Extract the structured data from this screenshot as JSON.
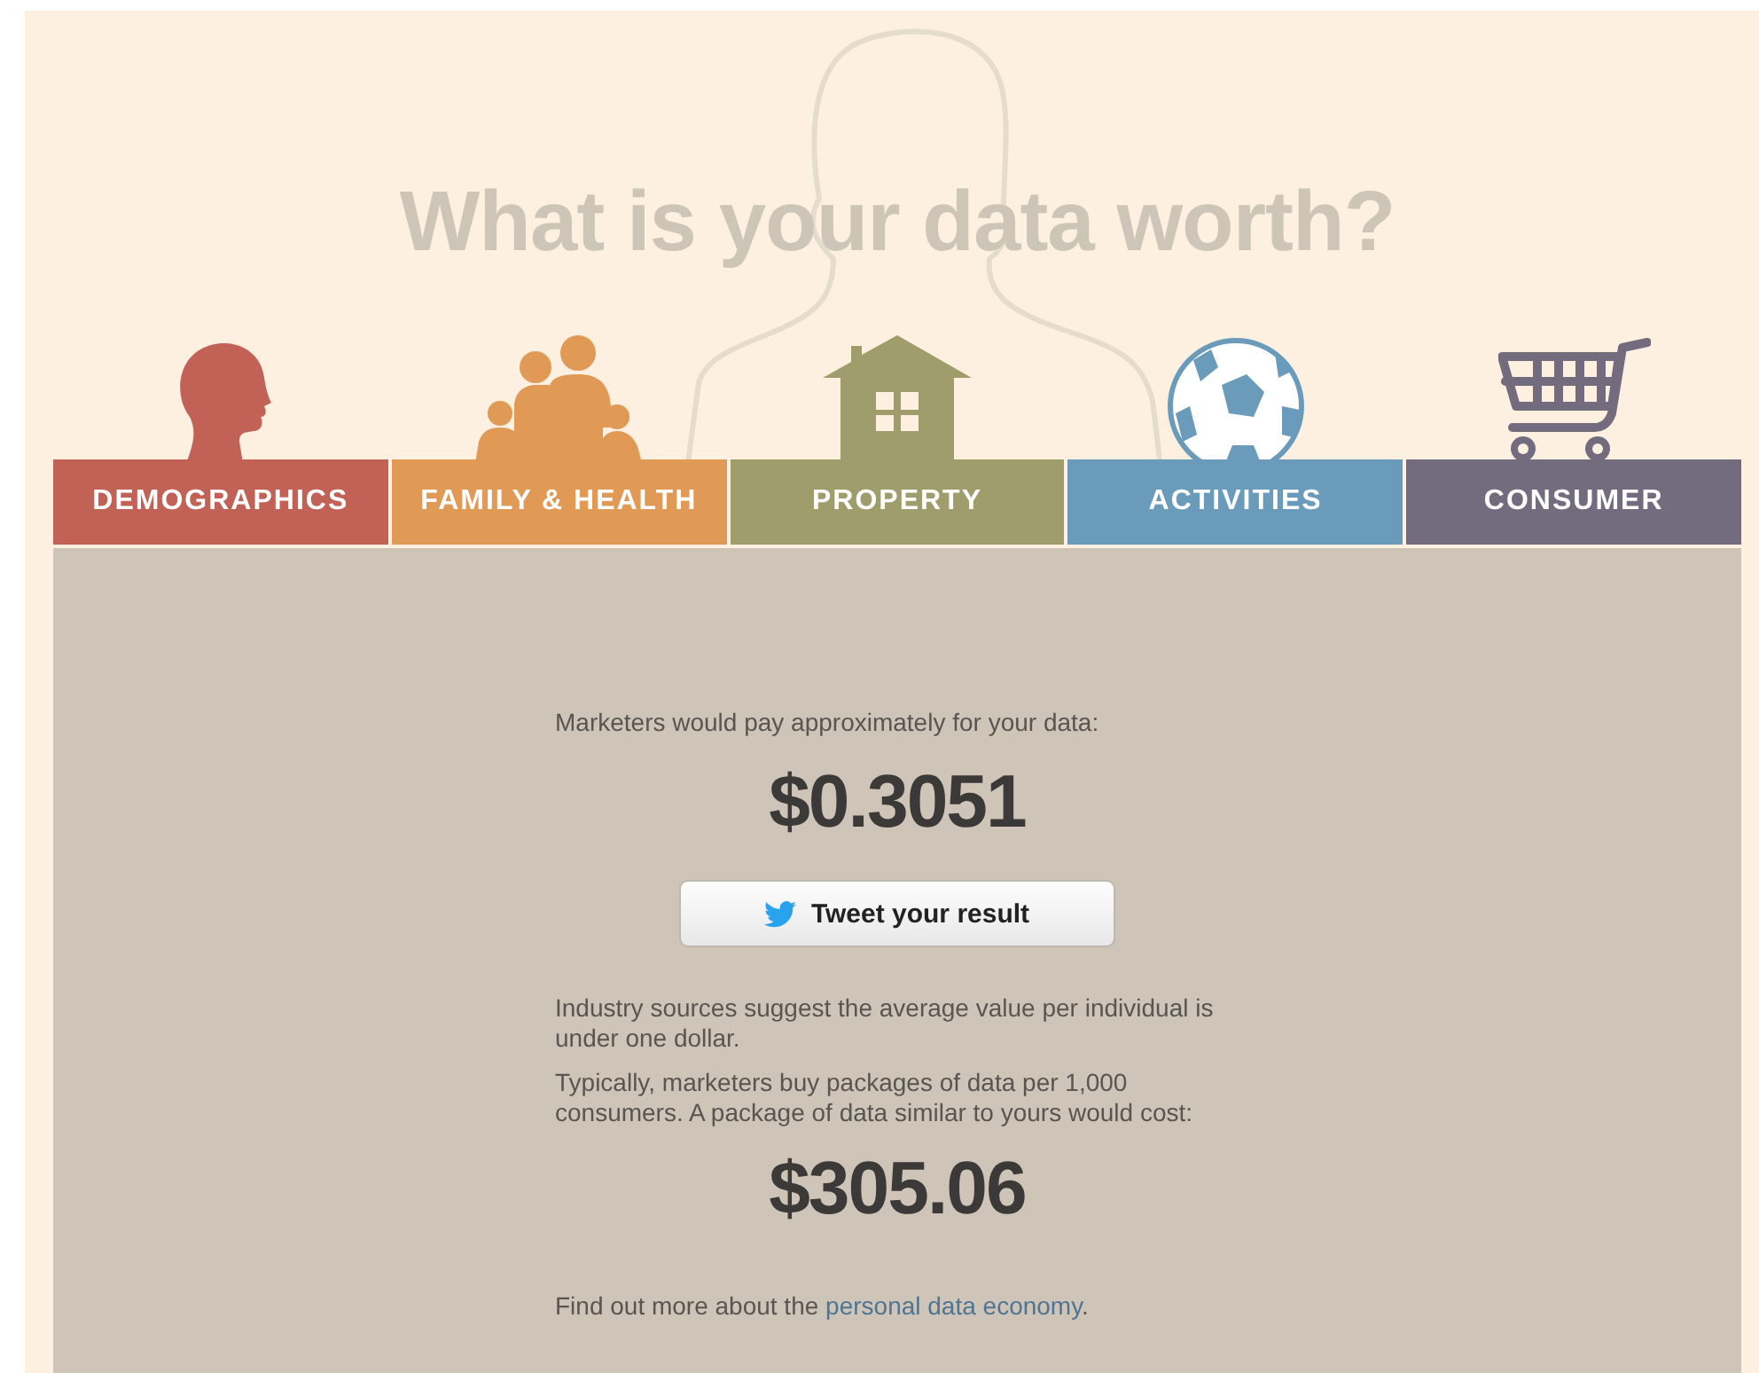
{
  "title": "What is your data worth?",
  "categories": [
    {
      "label": "DEMOGRAPHICS",
      "color": "#c26155"
    },
    {
      "label": "FAMILY & HEALTH",
      "color": "#e09a55"
    },
    {
      "label": "PROPERTY",
      "color": "#9e9d6b"
    },
    {
      "label": "ACTIVITIES",
      "color": "#6a9bba"
    },
    {
      "label": "CONSUMER",
      "color": "#736c7e"
    }
  ],
  "result": {
    "intro": "Marketers would pay approximately for your data:",
    "value": "$0.3051",
    "tweet_button": "Tweet your result",
    "note": "Industry sources suggest the average value per individual is under one dollar.",
    "package_text": "Typically, marketers buy packages of data per 1,000 consumers. A package of data similar to yours would cost:",
    "package_value": "$305.06",
    "more": {
      "text": "Find out more about the ",
      "link": "personal data economy",
      "after": "."
    }
  }
}
